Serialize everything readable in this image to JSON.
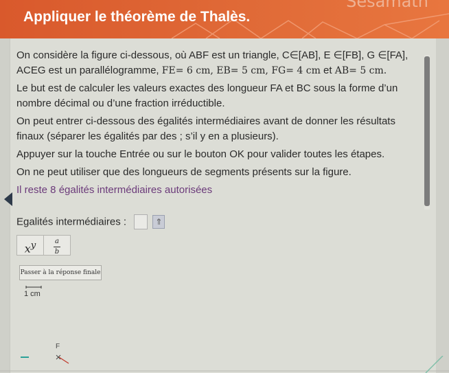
{
  "brand": "Sesamath",
  "title": "Appliquer le théorème de Thalès.",
  "statement": {
    "p1_a": "On considère la figure ci-dessous, où ABF est un triangle, C∈[AB], E ∈[FB], G ∈[FA],",
    "p1_b_text": "ACEG est un parallélogramme, ",
    "p1_b_math": "FE= 6 cm, EB= 5 cm, FG= 4 cm",
    "p1_b_and": " et ",
    "p1_b_math2": "AB= 5 cm.",
    "p2": "Le but est de calculer les valeurs exactes des longueur FA et BC sous la forme d’un nombre décimal ou d’une fraction irréductible.",
    "p3": "On peut entrer ci-dessous des égalités intermédiaires avant de donner les résultats finaux (séparer les égalités par des ; s’il y en a plusieurs).",
    "p4": "Appuyer sur la touche Entrée ou sur le bouton OK pour valider toutes les étapes.",
    "p5": "On ne peut utiliser que des longueurs de segments présents sur la figure.",
    "remaining": "Il reste 8 égalités intermédiaires autorisées"
  },
  "input": {
    "label": "Egalités intermédiaires :"
  },
  "buttons": {
    "power_base": "x",
    "power_exp": "y",
    "frac_num": "a",
    "frac_den": "b",
    "submit": "Passer à la réponse finale"
  },
  "figure": {
    "scale_label": "1 cm",
    "point_label": "F"
  },
  "colors": {
    "header": "#d9592c",
    "remaining_text": "#6b3a7a",
    "figure_line": "#c0392b",
    "figure_accent": "#2aa198"
  }
}
